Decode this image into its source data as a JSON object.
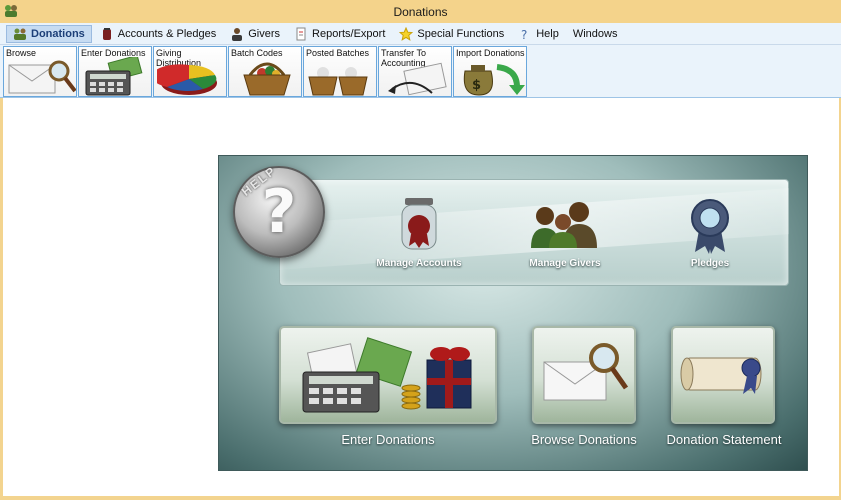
{
  "window": {
    "title": "Donations"
  },
  "menu": {
    "items": [
      {
        "label": "Donations",
        "icon": "people-icon",
        "active": true
      },
      {
        "label": "Accounts & Pledges",
        "icon": "jar-icon",
        "active": false
      },
      {
        "label": "Givers",
        "icon": "person-icon",
        "active": false
      },
      {
        "label": "Reports/Export",
        "icon": "report-icon",
        "active": false
      },
      {
        "label": "Special Functions",
        "icon": "star-icon",
        "active": false
      },
      {
        "label": "Help",
        "icon": "help-icon",
        "active": false
      },
      {
        "label": "Windows",
        "icon": "",
        "active": false
      }
    ]
  },
  "toolbar": {
    "buttons": [
      {
        "label": "Browse",
        "icon": "envelope-magnifier-icon"
      },
      {
        "label": "Enter Donations",
        "icon": "calculator-money-icon"
      },
      {
        "label": "Giving Distribution",
        "icon": "pie-chart-icon"
      },
      {
        "label": "Batch Codes",
        "icon": "basket-icon"
      },
      {
        "label": "Posted Batches",
        "icon": "baskets-icon"
      },
      {
        "label": "Transfer To Accounting",
        "icon": "transfer-arrow-icon"
      },
      {
        "label": "Import Donations",
        "icon": "money-bag-arrow-icon"
      }
    ]
  },
  "panel": {
    "help_text": "HELP",
    "help_symbol": "?",
    "top_items": [
      {
        "label": "Manage Accounts",
        "icon": "jar-icon"
      },
      {
        "label": "Manage Givers",
        "icon": "people-icon"
      },
      {
        "label": "Pledges",
        "icon": "badge-ribbon-icon"
      }
    ],
    "tiles": [
      {
        "label": "Enter Donations",
        "icon": "calculator-money-gift-icon"
      },
      {
        "label": "Browse Donations",
        "icon": "envelope-magnifier-icon"
      },
      {
        "label": "Donation Statement",
        "icon": "scroll-seal-icon"
      }
    ]
  },
  "colors": {
    "titlebar": "#f4d38b",
    "menubar": "#eaf3fb",
    "panel_dark": "#2f4f4f",
    "tool_border": "#6aa7dc"
  }
}
